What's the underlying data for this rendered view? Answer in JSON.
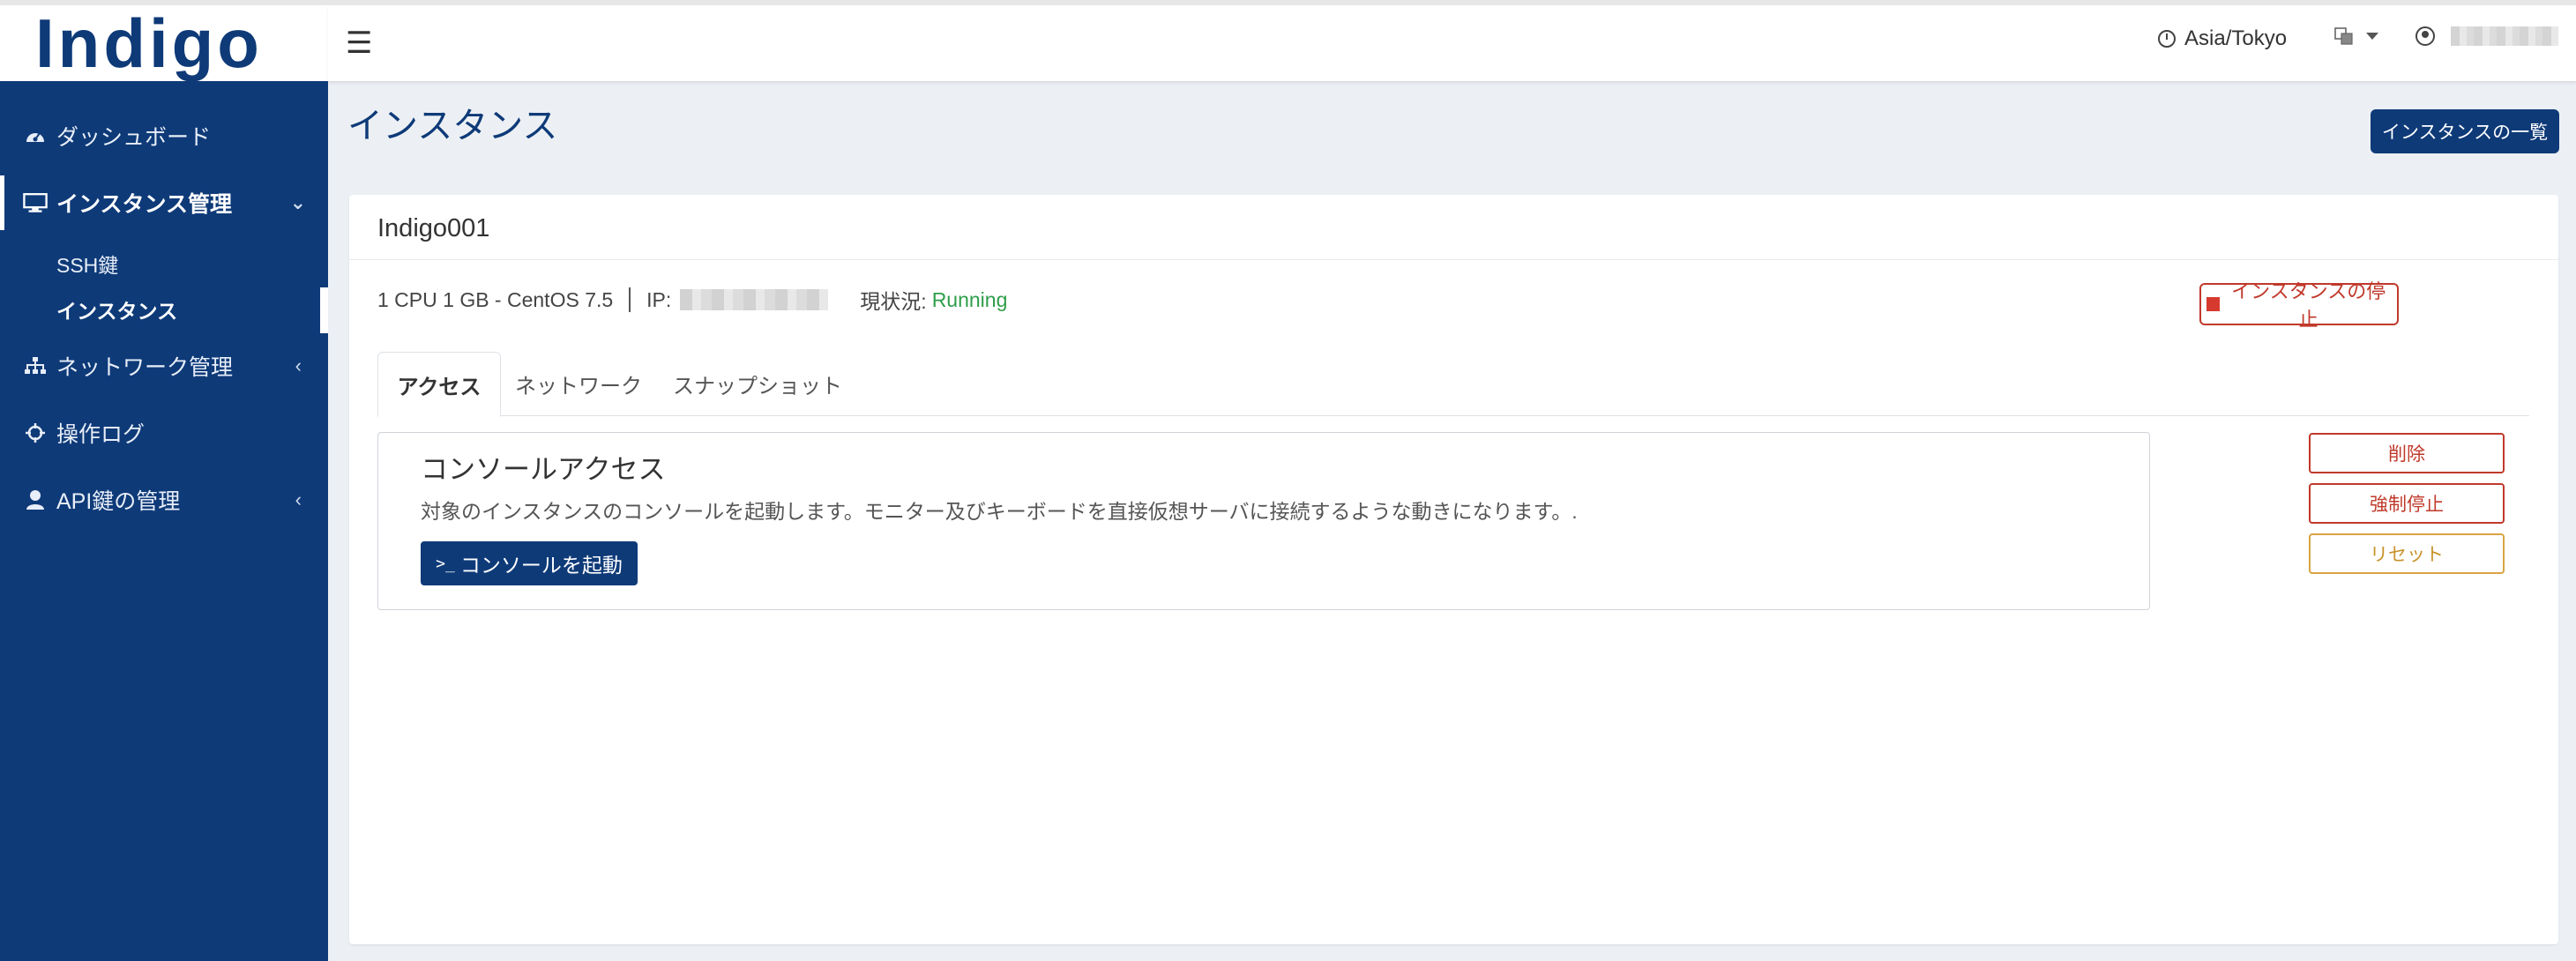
{
  "app": {
    "logo": "Indigo"
  },
  "header": {
    "timezone": "Asia/Tokyo",
    "language_icon": "translate-icon",
    "user_icon": "user-circle-icon"
  },
  "sidebar": {
    "items": [
      {
        "label": "ダッシュボード",
        "icon": "dashboard-icon"
      },
      {
        "label": "インスタンス管理",
        "icon": "desktop-icon",
        "expanded": true,
        "children": [
          {
            "label": "SSH鍵"
          },
          {
            "label": "インスタンス",
            "current": true
          }
        ]
      },
      {
        "label": "ネットワーク管理",
        "icon": "network-icon"
      },
      {
        "label": "操作ログ",
        "icon": "crosshair-icon"
      },
      {
        "label": "API鍵の管理",
        "icon": "user-icon"
      }
    ]
  },
  "page": {
    "title": "インスタンス",
    "list_button": "インスタンスの一覧"
  },
  "instance": {
    "name": "Indigo001",
    "spec": "1 CPU 1 GB - CentOS 7.5",
    "ip_label": "IP:",
    "status_label": "現状況:",
    "status_value": "Running",
    "stop_button": "インスタンスの停止"
  },
  "tabs": [
    {
      "label": "アクセス",
      "active": true
    },
    {
      "label": "ネットワーク"
    },
    {
      "label": "スナップショット"
    }
  ],
  "console": {
    "title": "コンソールアクセス",
    "description": "対象のインスタンスのコンソールを起動します。モニター及びキーボードを直接仮想サーバに接続するような動きになります。.",
    "button_prompt": ">_",
    "button_label": "コンソールを起動"
  },
  "actions": {
    "delete": "削除",
    "force_stop": "強制停止",
    "reset": "リセット"
  },
  "colors": {
    "brand": "#0e3a78",
    "danger": "#c0392b",
    "warning": "#d9a441",
    "running": "#2e9e4a"
  }
}
